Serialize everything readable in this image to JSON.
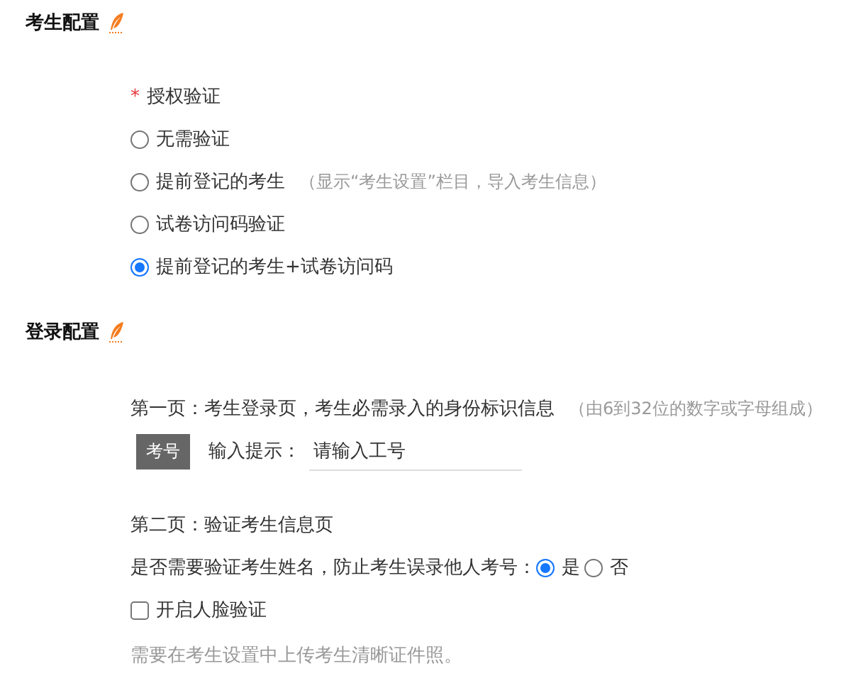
{
  "exam_config": {
    "title": "考生配置",
    "field": {
      "mark": "*",
      "label": "授权验证"
    },
    "options": [
      {
        "label": "无需验证",
        "selected": false
      },
      {
        "label": "提前登记的考生",
        "note": "（显示“考生设置”栏目，导入考生信息）",
        "selected": false
      },
      {
        "label": "试卷访问码验证",
        "selected": false
      },
      {
        "label": "提前登记的考生+试卷访问码",
        "selected": true
      }
    ]
  },
  "login_config": {
    "title": "登录配置",
    "page1": {
      "text": "第一页：考生登录页，考生必需录入的身份标识信息",
      "note": "（由6到32位的数字或字母组成）"
    },
    "id_tag": "考号",
    "input_label": "输入提示：",
    "input_value": "请输入工号",
    "page2": "第二页：验证考生信息页",
    "name_check": {
      "label": "是否需要验证考生姓名，防止考生误录他人考号：",
      "options": [
        {
          "label": "是",
          "selected": true
        },
        {
          "label": "否",
          "selected": false
        }
      ]
    },
    "face_check": {
      "label": "开启人脸验证",
      "checked": false
    },
    "face_hint": "需要在考生设置中上传考生清晰证件照。"
  }
}
